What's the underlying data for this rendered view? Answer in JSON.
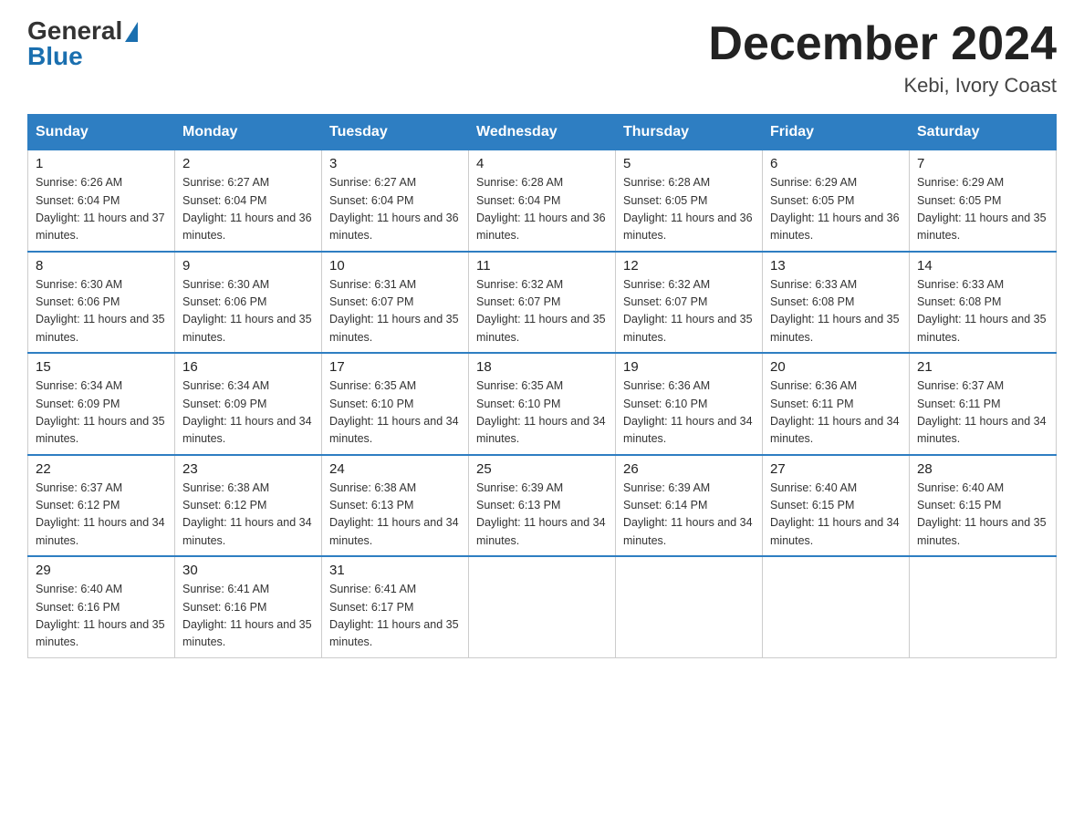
{
  "header": {
    "logo_general": "General",
    "logo_blue": "Blue",
    "title": "December 2024",
    "subtitle": "Kebi, Ivory Coast"
  },
  "columns": [
    "Sunday",
    "Monday",
    "Tuesday",
    "Wednesday",
    "Thursday",
    "Friday",
    "Saturday"
  ],
  "weeks": [
    [
      {
        "day": "1",
        "sunrise": "6:26 AM",
        "sunset": "6:04 PM",
        "daylight": "11 hours and 37 minutes."
      },
      {
        "day": "2",
        "sunrise": "6:27 AM",
        "sunset": "6:04 PM",
        "daylight": "11 hours and 36 minutes."
      },
      {
        "day": "3",
        "sunrise": "6:27 AM",
        "sunset": "6:04 PM",
        "daylight": "11 hours and 36 minutes."
      },
      {
        "day": "4",
        "sunrise": "6:28 AM",
        "sunset": "6:04 PM",
        "daylight": "11 hours and 36 minutes."
      },
      {
        "day": "5",
        "sunrise": "6:28 AM",
        "sunset": "6:05 PM",
        "daylight": "11 hours and 36 minutes."
      },
      {
        "day": "6",
        "sunrise": "6:29 AM",
        "sunset": "6:05 PM",
        "daylight": "11 hours and 36 minutes."
      },
      {
        "day": "7",
        "sunrise": "6:29 AM",
        "sunset": "6:05 PM",
        "daylight": "11 hours and 35 minutes."
      }
    ],
    [
      {
        "day": "8",
        "sunrise": "6:30 AM",
        "sunset": "6:06 PM",
        "daylight": "11 hours and 35 minutes."
      },
      {
        "day": "9",
        "sunrise": "6:30 AM",
        "sunset": "6:06 PM",
        "daylight": "11 hours and 35 minutes."
      },
      {
        "day": "10",
        "sunrise": "6:31 AM",
        "sunset": "6:07 PM",
        "daylight": "11 hours and 35 minutes."
      },
      {
        "day": "11",
        "sunrise": "6:32 AM",
        "sunset": "6:07 PM",
        "daylight": "11 hours and 35 minutes."
      },
      {
        "day": "12",
        "sunrise": "6:32 AM",
        "sunset": "6:07 PM",
        "daylight": "11 hours and 35 minutes."
      },
      {
        "day": "13",
        "sunrise": "6:33 AM",
        "sunset": "6:08 PM",
        "daylight": "11 hours and 35 minutes."
      },
      {
        "day": "14",
        "sunrise": "6:33 AM",
        "sunset": "6:08 PM",
        "daylight": "11 hours and 35 minutes."
      }
    ],
    [
      {
        "day": "15",
        "sunrise": "6:34 AM",
        "sunset": "6:09 PM",
        "daylight": "11 hours and 35 minutes."
      },
      {
        "day": "16",
        "sunrise": "6:34 AM",
        "sunset": "6:09 PM",
        "daylight": "11 hours and 34 minutes."
      },
      {
        "day": "17",
        "sunrise": "6:35 AM",
        "sunset": "6:10 PM",
        "daylight": "11 hours and 34 minutes."
      },
      {
        "day": "18",
        "sunrise": "6:35 AM",
        "sunset": "6:10 PM",
        "daylight": "11 hours and 34 minutes."
      },
      {
        "day": "19",
        "sunrise": "6:36 AM",
        "sunset": "6:10 PM",
        "daylight": "11 hours and 34 minutes."
      },
      {
        "day": "20",
        "sunrise": "6:36 AM",
        "sunset": "6:11 PM",
        "daylight": "11 hours and 34 minutes."
      },
      {
        "day": "21",
        "sunrise": "6:37 AM",
        "sunset": "6:11 PM",
        "daylight": "11 hours and 34 minutes."
      }
    ],
    [
      {
        "day": "22",
        "sunrise": "6:37 AM",
        "sunset": "6:12 PM",
        "daylight": "11 hours and 34 minutes."
      },
      {
        "day": "23",
        "sunrise": "6:38 AM",
        "sunset": "6:12 PM",
        "daylight": "11 hours and 34 minutes."
      },
      {
        "day": "24",
        "sunrise": "6:38 AM",
        "sunset": "6:13 PM",
        "daylight": "11 hours and 34 minutes."
      },
      {
        "day": "25",
        "sunrise": "6:39 AM",
        "sunset": "6:13 PM",
        "daylight": "11 hours and 34 minutes."
      },
      {
        "day": "26",
        "sunrise": "6:39 AM",
        "sunset": "6:14 PM",
        "daylight": "11 hours and 34 minutes."
      },
      {
        "day": "27",
        "sunrise": "6:40 AM",
        "sunset": "6:15 PM",
        "daylight": "11 hours and 34 minutes."
      },
      {
        "day": "28",
        "sunrise": "6:40 AM",
        "sunset": "6:15 PM",
        "daylight": "11 hours and 35 minutes."
      }
    ],
    [
      {
        "day": "29",
        "sunrise": "6:40 AM",
        "sunset": "6:16 PM",
        "daylight": "11 hours and 35 minutes."
      },
      {
        "day": "30",
        "sunrise": "6:41 AM",
        "sunset": "6:16 PM",
        "daylight": "11 hours and 35 minutes."
      },
      {
        "day": "31",
        "sunrise": "6:41 AM",
        "sunset": "6:17 PM",
        "daylight": "11 hours and 35 minutes."
      },
      null,
      null,
      null,
      null
    ]
  ]
}
